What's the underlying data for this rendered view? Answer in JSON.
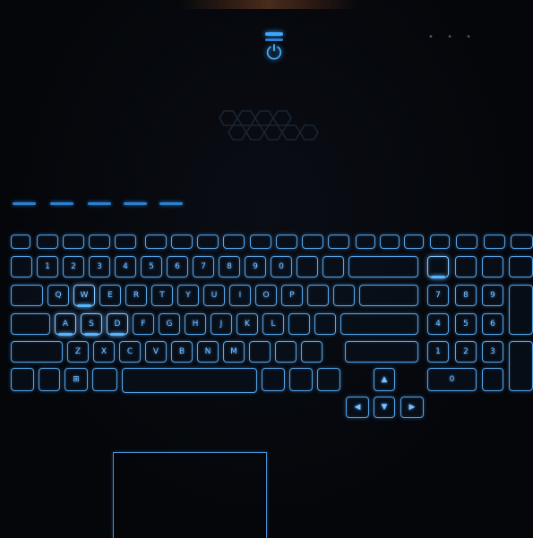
{
  "scene": {
    "description_free": true,
    "palette": {
      "background": "#05070b",
      "keyGlow": "#56a4e6",
      "accent": "#3fa6ff"
    }
  },
  "power_button": {
    "icon": "power-icon",
    "glyph": "⏻"
  },
  "keys": {
    "row_f": [
      "",
      "",
      "",
      "",
      "",
      "",
      "",
      "",
      "",
      "",
      "",
      "",
      "",
      "",
      "",
      "",
      "",
      "",
      "",
      "",
      "",
      "",
      ""
    ],
    "row_num": [
      "",
      "1",
      "2",
      "3",
      "4",
      "5",
      "6",
      "7",
      "8",
      "9",
      "0",
      "",
      "",
      "",
      "",
      "",
      "",
      "",
      ""
    ],
    "row_q": [
      "",
      "Q",
      "W",
      "E",
      "R",
      "T",
      "Y",
      "U",
      "I",
      "O",
      "P",
      "",
      "",
      "",
      "7",
      "8",
      "9",
      ""
    ],
    "row_a": [
      "",
      "A",
      "S",
      "D",
      "F",
      "G",
      "H",
      "J",
      "K",
      "L",
      "",
      "",
      "",
      "4",
      "5",
      "6",
      ""
    ],
    "row_z": [
      "",
      "Z",
      "X",
      "C",
      "V",
      "B",
      "N",
      "M",
      "",
      "",
      "",
      "",
      "1",
      "2",
      "3",
      ""
    ],
    "row_bottom": [
      "",
      "",
      "⊞",
      "",
      "",
      "",
      "",
      "",
      "0",
      ""
    ],
    "arrows": {
      "up": "▲",
      "left": "◀",
      "down": "▼",
      "right": "▶"
    }
  }
}
